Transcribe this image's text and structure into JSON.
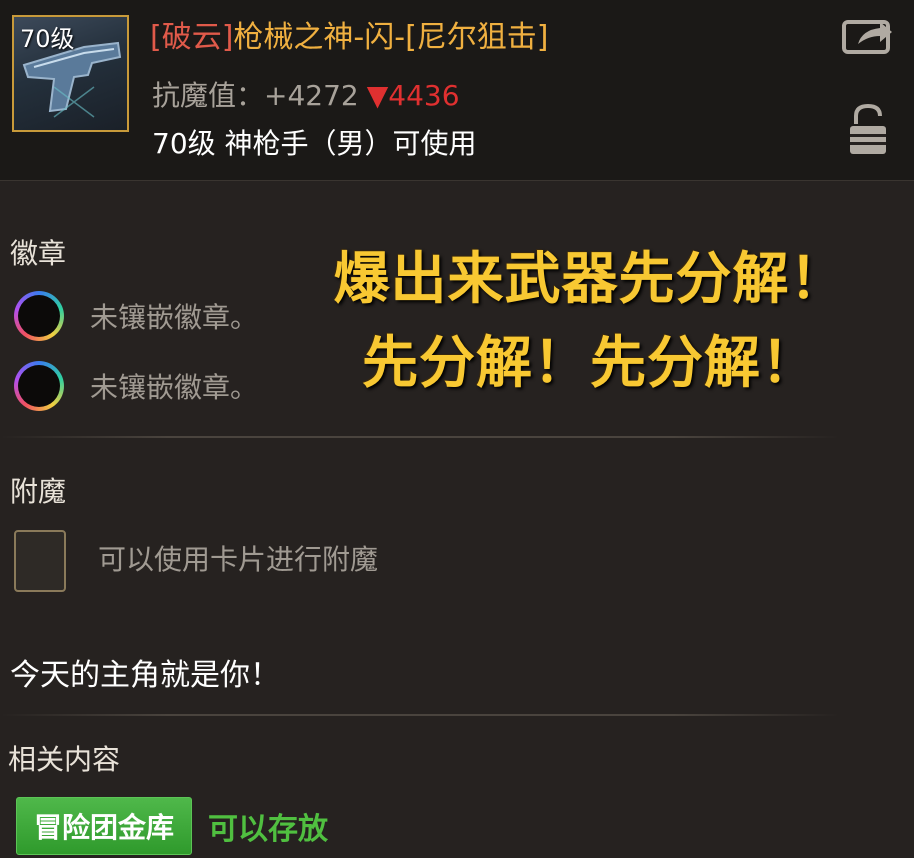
{
  "item": {
    "level_badge": "70级",
    "tag": "[破云]",
    "name": "枪械之神-闪-[尼尔狙击]",
    "stat_label": "抗魔值：",
    "stat_value": "+4272",
    "stat_compare_arrow": "▼",
    "stat_compare": "4436",
    "requirement": "70级 神枪手（男）可使用",
    "icon": "pistol-icon"
  },
  "actions": {
    "share_icon": "share-icon",
    "lock_icon": "lock-icon"
  },
  "badge_section": {
    "title": "徽章",
    "slots": [
      {
        "text": "未镶嵌徽章。"
      },
      {
        "text": "未镶嵌徽章。"
      }
    ]
  },
  "overlay": {
    "line1": "爆出来武器先分解！",
    "line2": "先分解！先分解！"
  },
  "enchant_section": {
    "title": "附魔",
    "hint": "可以使用卡片进行附魔"
  },
  "flavor_text": "今天的主角就是你！",
  "related_section": {
    "title": "相关内容",
    "button": "冒险团金库",
    "note": "可以存放"
  },
  "colors": {
    "item_name": "#f0b040",
    "item_tag": "#e05a4a",
    "stat_down": "#e03030",
    "overlay_text": "#f8c832",
    "button_green": "#3aa834",
    "note_green": "#50c040"
  }
}
